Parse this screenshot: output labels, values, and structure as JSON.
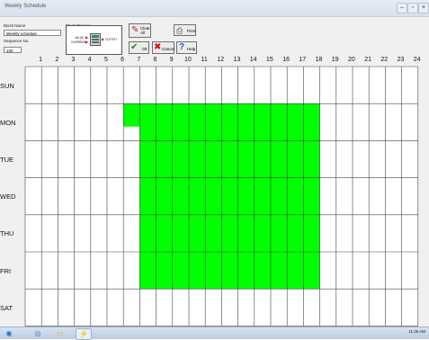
{
  "window": {
    "title": "Weekly Schedule"
  },
  "form": {
    "block_name_label": "Block Name",
    "block_name_value": "Weekly schedule",
    "sequence_label": "Sequence No.",
    "sequence_value": "100",
    "preview_label": "Block Preview",
    "preview_input_value": "VALUE",
    "preview_input_override": "OVERRIDE",
    "preview_output": "OUTPUT"
  },
  "buttons": {
    "clear_all": "Clear All",
    "print": "Print",
    "ok": "Ok",
    "cancel": "Cancel",
    "help": "Help"
  },
  "grid": {
    "hours": [
      "1",
      "2",
      "3",
      "4",
      "5",
      "6",
      "7",
      "8",
      "9",
      "10",
      "11",
      "12",
      "13",
      "14",
      "15",
      "16",
      "17",
      "18",
      "19",
      "20",
      "21",
      "22",
      "23",
      "24"
    ],
    "days": [
      "SUN",
      "MON",
      "TUE",
      "WED",
      "THU",
      "FRI",
      "SAT"
    ],
    "active_color": "#00ff00",
    "schedule": {
      "MON": [
        6,
        17
      ],
      "TUE": [
        7,
        17
      ],
      "WED": [
        7,
        17
      ],
      "THU": [
        7,
        17
      ],
      "FRI": [
        7,
        17
      ]
    },
    "mon_partial_hour": 6
  },
  "taskbar": {
    "clock": "11:36 AM"
  }
}
